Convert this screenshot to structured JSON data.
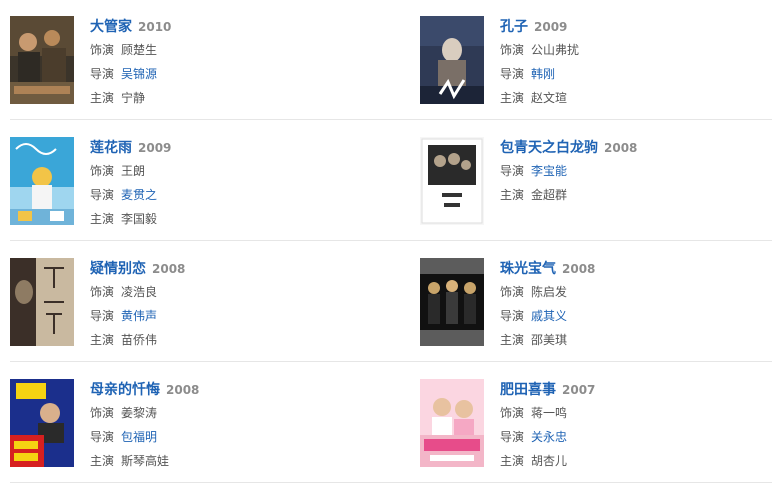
{
  "labels": {
    "plays": "饰演",
    "director": "导演",
    "starring": "主演"
  },
  "colors": {
    "title_link": "#1f63b4",
    "year": "#8c8c8c",
    "meta_text": "#555555",
    "separator": "#e6e6e6"
  },
  "items": [
    {
      "title": "大管家",
      "year": "2010",
      "role": "顾楚生",
      "director": "吴锦源",
      "star": "宁静",
      "poster_icon": "poster-da-guan-jia",
      "poster_colors": [
        "#5a4a35",
        "#2e2a24",
        "#b98a5a"
      ]
    },
    {
      "title": "孔子",
      "year": "2009",
      "role": "公山弗扰",
      "director": "韩刚",
      "star": "赵文瑄",
      "poster_icon": "poster-kong-zi",
      "poster_colors": [
        "#2f3a55",
        "#7a6f67",
        "#d9cdbf"
      ]
    },
    {
      "title": "莲花雨",
      "year": "2009",
      "role": "王朗",
      "director": "麦贯之",
      "star": "李国毅",
      "poster_icon": "poster-lian-hua-yu",
      "poster_colors": [
        "#3aa6d8",
        "#9fd6ef",
        "#f2c447"
      ]
    },
    {
      "title": "包青天之白龙驹",
      "year": "2008",
      "role": "",
      "director": "李宝能",
      "star": "金超群",
      "poster_icon": "poster-bao-qing-tian",
      "poster_colors": [
        "#f6f6f6",
        "#2a2a2a",
        "#b3a28b"
      ]
    },
    {
      "title": "疑情别恋",
      "year": "2008",
      "role": "凌浩良",
      "director": "黄伟声",
      "star": "苗侨伟",
      "poster_icon": "poster-yi-qing-bie-lian",
      "poster_colors": [
        "#c9b9a0",
        "#3b2f28",
        "#8e7b63"
      ]
    },
    {
      "title": "珠光宝气",
      "year": "2008",
      "role": "陈启发",
      "director": "戚其义",
      "star": "邵美琪",
      "poster_icon": "poster-zhu-guang-bao-qi",
      "poster_colors": [
        "#111111",
        "#5c5c5c",
        "#c8a46a"
      ]
    },
    {
      "title": "母亲的忏悔",
      "year": "2008",
      "role": "姜黎涛",
      "director": "包福明",
      "star": "斯琴高娃",
      "poster_icon": "poster-mu-qin-de-chan-hui",
      "poster_colors": [
        "#1b2f8c",
        "#d62020",
        "#f5d312"
      ]
    },
    {
      "title": "肥田喜事",
      "year": "2007",
      "role": "蒋一鸣",
      "director": "关永忠",
      "star": "胡杏儿",
      "poster_icon": "poster-fei-tian-xi-shi",
      "poster_colors": [
        "#f3b6c8",
        "#ffffff",
        "#e74c8a"
      ]
    }
  ]
}
